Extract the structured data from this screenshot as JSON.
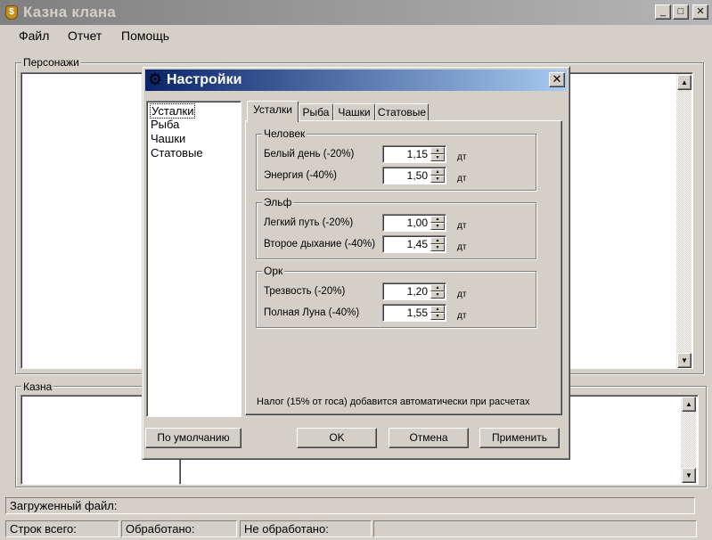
{
  "window": {
    "title": "Казна клана",
    "menu": [
      "Файл",
      "Отчет",
      "Помощь"
    ],
    "caption_buttons": {
      "minimize": "_",
      "maximize": "□",
      "close": "✕"
    }
  },
  "groups": {
    "characters_label": "Персонажи",
    "treasury_label": "Казна"
  },
  "status": {
    "loaded_file": "Загруженный файл:",
    "rows_total": "Строк всего:",
    "processed": "Обработано:",
    "not_processed": "Не обработано:"
  },
  "dialog": {
    "title": "Настройки",
    "close": "✕",
    "nav_items": [
      "Усталки",
      "Рыба",
      "Чашки",
      "Статовые"
    ],
    "tabs": [
      "Усталки",
      "Рыба",
      "Чашки",
      "Статовые"
    ],
    "active_tab": "Усталки",
    "unit": "дт",
    "races": [
      {
        "name": "Человек",
        "fields": [
          {
            "label": "Белый день (-20%)",
            "value": "1,15"
          },
          {
            "label": "Энергия (-40%)",
            "value": "1,50"
          }
        ]
      },
      {
        "name": "Эльф",
        "fields": [
          {
            "label": "Легкий путь (-20%)",
            "value": "1,00"
          },
          {
            "label": "Второе дыхание (-40%)",
            "value": "1,45"
          }
        ]
      },
      {
        "name": "Орк",
        "fields": [
          {
            "label": "Трезвость (-20%)",
            "value": "1,20"
          },
          {
            "label": "Полная Луна (-40%)",
            "value": "1,55"
          }
        ]
      }
    ],
    "note": "Налог (15% от госа) добавится автоматически при расчетах",
    "buttons": {
      "defaults": "По умолчанию",
      "ok": "OK",
      "cancel": "Отмена",
      "apply": "Применить"
    }
  },
  "colors": {
    "face": "#d4d0c8",
    "dialog_title_start": "#0a246a",
    "dialog_title_end": "#a6caf0"
  }
}
